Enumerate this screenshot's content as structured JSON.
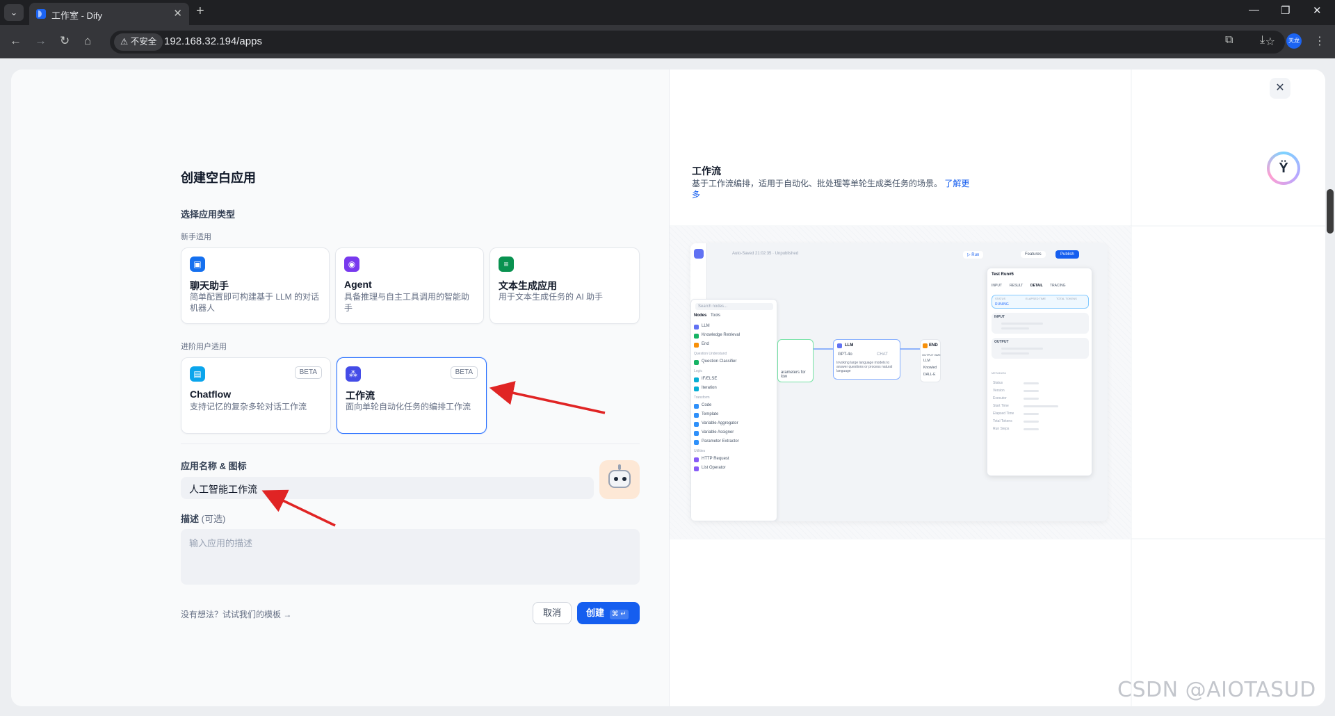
{
  "browser": {
    "tab_title": "工作室 - Dify",
    "insecure_label": "不安全",
    "url": "192.168.32.194/apps",
    "profile_label": "天龙"
  },
  "modal": {
    "title": "创建空白应用",
    "select_type_label": "选择应用类型",
    "beginner_label": "新手适用",
    "advanced_label": "进阶用户适用",
    "beginner_cards": [
      {
        "title": "聊天助手",
        "desc": "简单配置即可构建基于 LLM 的对话机器人",
        "icon": "chat-bot-icon",
        "color": "#1570ef"
      },
      {
        "title": "Agent",
        "desc": "具备推理与自主工具调用的智能助手",
        "icon": "agent-icon",
        "color": "#7839ee"
      },
      {
        "title": "文本生成应用",
        "desc": "用于文本生成任务的 AI 助手",
        "icon": "text-gen-icon",
        "color": "#099250"
      }
    ],
    "advanced_cards": [
      {
        "title": "Chatflow",
        "desc": "支持记忆的复杂多轮对话工作流",
        "badge": "BETA",
        "icon": "chatflow-icon",
        "color": "#0ba5ec"
      },
      {
        "title": "工作流",
        "desc": "面向单轮自动化任务的编排工作流",
        "badge": "BETA",
        "icon": "workflow-icon",
        "color": "#444ce7",
        "selected": true
      }
    ],
    "name_label": "应用名称 & 图标",
    "name_value": "人工智能工作流",
    "desc_label": "描述",
    "desc_optional": "(可选)",
    "desc_placeholder": "输入应用的描述",
    "template_link": "没有想法？试试我们的模板",
    "cancel_label": "取消",
    "create_label": "创建",
    "create_shortcut": "⌘ ↵"
  },
  "preview_pane": {
    "title": "工作流",
    "desc": "基于工作流编排，适用于自动化、批处理等单轮生成类任务的场景。",
    "more_link": "了解更多",
    "screenshot": {
      "autosave": "Auto-Saved 21:02:35 · Unpublished",
      "run_label": "Run",
      "features_label": "Features",
      "publish_label": "Publish",
      "search_placeholder": "Search nodes...",
      "tabs": [
        "Nodes",
        "Tools"
      ],
      "node_list": [
        {
          "label": "LLM",
          "color": "#6172f3"
        },
        {
          "label": "Knowledge Retrieval",
          "color": "#16b364"
        },
        {
          "label": "End",
          "color": "#f79009"
        },
        {
          "label": "Question Understand",
          "color": ""
        },
        {
          "label": "Question Classifier",
          "color": "#16b364"
        },
        {
          "label": "Logic",
          "color": ""
        },
        {
          "label": "IF/ELSE",
          "color": "#06aed4"
        },
        {
          "label": "Iteration",
          "color": "#06aed4"
        },
        {
          "label": "Transform",
          "color": ""
        },
        {
          "label": "Code",
          "color": "#2e90fa"
        },
        {
          "label": "Template",
          "color": "#2e90fa"
        },
        {
          "label": "Variable Aggregator",
          "color": "#2e90fa"
        },
        {
          "label": "Variable Assigner",
          "color": "#2e90fa"
        },
        {
          "label": "Parameter Extractor",
          "color": "#2e90fa"
        },
        {
          "label": "Utilities",
          "color": ""
        },
        {
          "label": "HTTP Request",
          "color": "#875bf7"
        },
        {
          "label": "List Operator",
          "color": "#875bf7"
        }
      ],
      "llm_node": {
        "title": "LLM",
        "model": "GPT-4o",
        "mode": "CHAT",
        "desc": "Invoking large language models to answer questions or process natural language"
      },
      "end_node": {
        "title": "END",
        "output_label": "OUTPUT VARI",
        "items": [
          "LLM",
          "Knowled",
          "DALL-E"
        ]
      },
      "start_node_desc": "arameters for low",
      "run_panel": {
        "title": "Test Run#5",
        "tabs": [
          "INPUT",
          "RESULT",
          "DETAIL",
          "TRACING"
        ],
        "status_label": "STATUS",
        "status_value": "RUNING",
        "elapsed_label": "ELAPSED TIME",
        "tokens_label": "TOTAL TOKENS",
        "input_label": "INPUT",
        "output_label": "OUTPUT",
        "metadata_label": "METADATA",
        "metadata_fields": [
          "Status",
          "Version",
          "Executor",
          "Start Time",
          "Elapsed Time",
          "Total Tokens",
          "Run Steps"
        ]
      }
    }
  },
  "watermark": "CSDN @AIOTASUD"
}
